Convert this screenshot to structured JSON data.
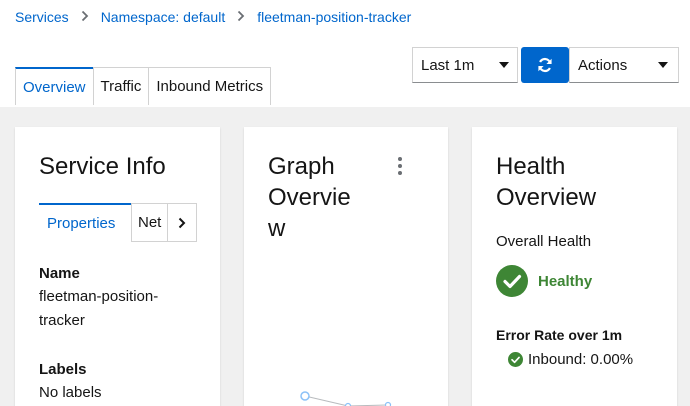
{
  "breadcrumb": {
    "items": [
      "Services",
      "Namespace: default",
      "fleetman-position-tracker"
    ],
    "separator": ">"
  },
  "toolbar": {
    "time_range": "Last 1m",
    "refresh_icon": "refresh-icon",
    "actions_label": "Actions"
  },
  "tabs": [
    {
      "label": "Overview",
      "active": true
    },
    {
      "label": "Traffic",
      "active": false
    },
    {
      "label": "Inbound Metrics",
      "active": false
    }
  ],
  "service_info": {
    "title": "Service Info",
    "tabs": [
      "Properties",
      "Net"
    ],
    "name_label": "Name",
    "name_value": "fleetman-position-tracker",
    "labels_label": "Labels",
    "labels_value": "No labels"
  },
  "graph_overview": {
    "title": "Graph Overview"
  },
  "health_overview": {
    "title": "Health Overview",
    "overall_label": "Overall Health",
    "status": "Healthy",
    "error_rate_label": "Error Rate over 1m",
    "inbound": "Inbound: 0.00%"
  },
  "colors": {
    "accent": "#0066cc",
    "healthy": "#3e8635",
    "page_bg": "#f0f0f0"
  }
}
